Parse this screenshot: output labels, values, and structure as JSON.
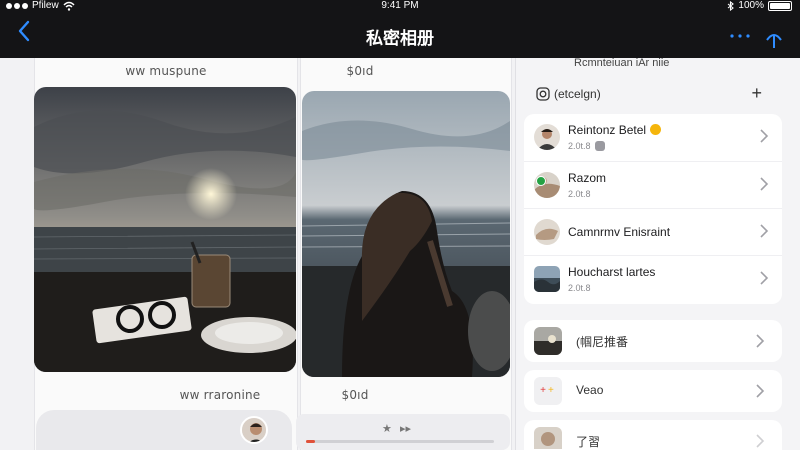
{
  "status_bar": {
    "carrier": "Pfilew",
    "time": "9:41 PM",
    "battery": "100%",
    "icons": [
      "signal-dots-icon",
      "wifi-icon",
      "bluetooth-icon",
      "battery-icon"
    ]
  },
  "nav": {
    "title": "私密相册",
    "icons": [
      "back-chevron-icon",
      "more-icon",
      "upload-icon"
    ],
    "accent": "#2f8cff"
  },
  "gallery": {
    "columns": [
      {
        "top_caption": "ww muspune",
        "bottom_caption": "ww rraronine"
      },
      {
        "top_caption": "$0ıd",
        "bottom_caption": "$0ıd"
      }
    ],
    "player_controls": [
      "★",
      "▸▸"
    ],
    "playback_progress": 0.05,
    "progress_color": "#e0513a"
  },
  "panel": {
    "top_partial_text": "Rcmnteiuan iAr niie",
    "section": {
      "label": "(etcelgn)",
      "action": "+"
    },
    "rows": [
      {
        "name": "Reintonz Betel",
        "sub": "2.0t.8",
        "gold_badge": true,
        "gray_badge": true
      },
      {
        "name": "Razom",
        "sub": "2.0t.8",
        "verified": true
      },
      {
        "name": "Camnrmv Enisraint",
        "sub": ""
      },
      {
        "name": "Houcharst lartes",
        "sub": "2.0t.8"
      }
    ],
    "cards": [
      {
        "label": "(帼尼推番",
        "type": "photo"
      },
      {
        "label": "Veao",
        "type": "video"
      },
      {
        "label": "了習",
        "type": "photo"
      }
    ],
    "icons": [
      "instagram-icon",
      "plus-icon",
      "chevron-right-icon"
    ],
    "verified_color": "#25a244",
    "gold_badge_color": "#f5b50b"
  }
}
